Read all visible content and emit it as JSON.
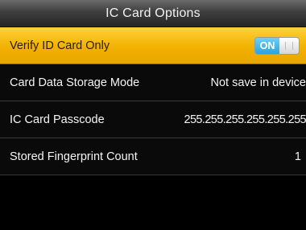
{
  "header": {
    "title": "IC Card Options"
  },
  "menu": {
    "items": [
      {
        "label": "Verify ID Card Only",
        "toggle_state": "ON"
      },
      {
        "label": "Card Data Storage Mode",
        "value": "Not save in device"
      },
      {
        "label": "IC Card Passcode",
        "value": "255.255.255.255.255.255"
      },
      {
        "label": "Stored Fingerprint Count",
        "value": "1"
      }
    ]
  },
  "colors": {
    "selected_row": "#f3b100",
    "toggle_on": "#2aa3dd",
    "title_bar": "#3e3e3e",
    "background": "#000000"
  }
}
